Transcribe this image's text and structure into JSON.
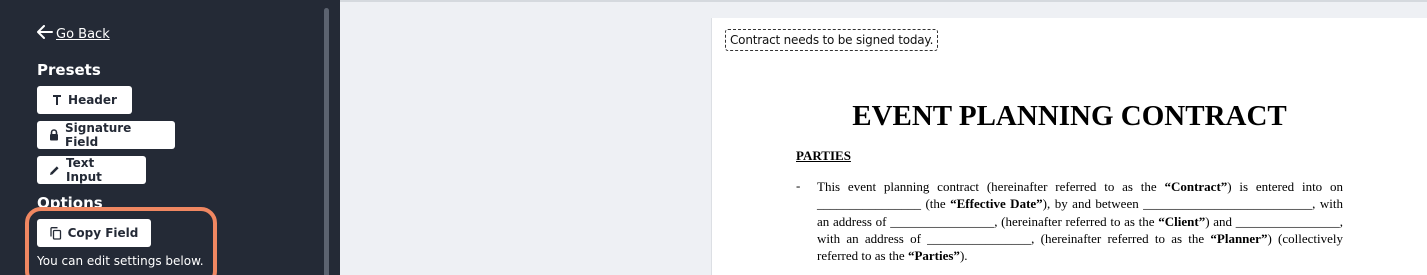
{
  "sidebar": {
    "go_back": "Go Back",
    "presets_title": "Presets",
    "presets": [
      {
        "label": "Header",
        "icon": "text-icon"
      },
      {
        "label": "Signature Field",
        "icon": "lock-icon"
      },
      {
        "label": "Text Input",
        "icon": "pencil-icon"
      }
    ],
    "options_title": "Options",
    "copy_field_label": "Copy Field",
    "hint": "You can edit settings below."
  },
  "document": {
    "note": "Contract needs to be signed today.",
    "title": "EVENT PLANNING CONTRACT",
    "section_heading": "PARTIES",
    "bullet": "-",
    "paragraph": {
      "t1": "This event planning contract (hereinafter referred to as the ",
      "b1": "“Contract”",
      "t2": ") is entered into on ________________ (the ",
      "b2": "“Effective Date”",
      "t3": "), by and between __________________________, with an address of ________________, (hereinafter referred to as the ",
      "b3": "“Client”",
      "t4": ") and ________________, with an address of ________________, (hereinafter referred to as the ",
      "b4": "“Planner”",
      "t5": ") (collectively referred to as the ",
      "b5": "“Parties”",
      "t6": ")."
    }
  },
  "colors": {
    "sidebar_bg": "#242a36",
    "highlight": "#f08761"
  }
}
